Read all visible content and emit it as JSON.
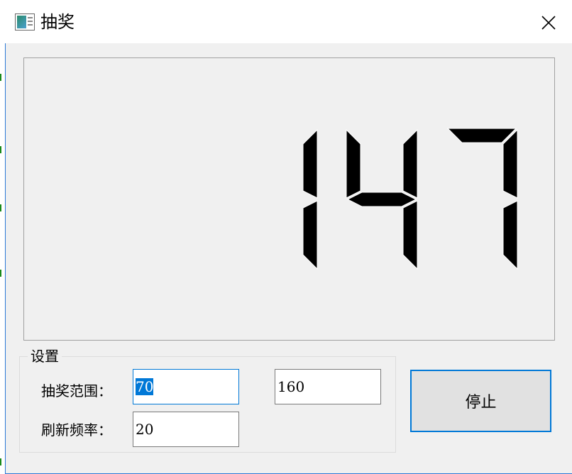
{
  "window": {
    "title": "抽奖",
    "icon": "app-window-icon",
    "close_icon": "close-icon"
  },
  "display": {
    "value": "147",
    "segment_color": "#000000"
  },
  "settings": {
    "group_label": "设置",
    "range_label": "抽奖范围：",
    "range_min": "70",
    "range_max": "160",
    "refresh_label": "刷新频率：",
    "refresh_value": "20"
  },
  "actions": {
    "stop_label": "停止"
  },
  "colors": {
    "accent": "#0078d7",
    "window_bg": "#f0f0f0",
    "title_bg": "#ffffff"
  }
}
